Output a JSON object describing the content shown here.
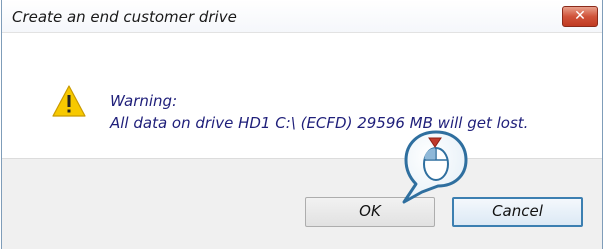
{
  "window": {
    "title": "Create an end customer drive",
    "close_glyph": "✕"
  },
  "message": {
    "heading": "Warning:",
    "body": "All data on drive HD1 C:\\ (ECFD) 29596 MB will get lost."
  },
  "buttons": {
    "ok_label": "OK",
    "cancel_label": "Cancel"
  },
  "icons": {
    "warning": "warning-triangle-icon",
    "pointer": "mouse-click-callout-icon"
  },
  "colors": {
    "warning_yellow": "#f7c900",
    "message_text": "#1f1f7a",
    "close_red": "#c8452c",
    "cancel_focus_border": "#3c7fb1",
    "callout_blue": "#2f6f9f"
  }
}
